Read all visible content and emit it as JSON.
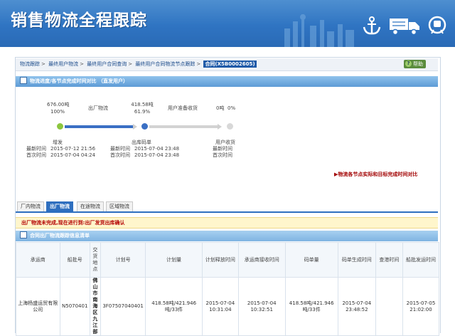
{
  "header": {
    "title": "销售物流全程跟踪"
  },
  "breadcrumb": {
    "items": [
      "物流跟踪",
      "最终用户物流",
      "最终用户合同查询",
      "最终用户合同物流节点跟踪"
    ],
    "current": "合同(X5B0002605)"
  },
  "help_label": "帮助",
  "progress_section": {
    "title": "物流进度/各节点完成时间对比 （直发用户）",
    "stages": [
      {
        "amount": "676.00吨",
        "percent": "100%",
        "status": ""
      },
      {
        "amount": "",
        "percent": "",
        "status": "出厂物流"
      },
      {
        "amount": "418.58吨",
        "percent": "61.9%",
        "status": ""
      },
      {
        "amount": "",
        "percent": "",
        "status": "用户准备收货"
      },
      {
        "amount": "0吨",
        "percent": "0%",
        "status": ""
      }
    ],
    "progress": {
      "segment1": 1.0,
      "segment2": 0.0
    },
    "nodes": [
      {
        "name": "增发",
        "latest_label": "最新时间",
        "latest": "2015-07-12 21:56",
        "first_label": "首次时间",
        "first": "2015-07-04 04:24"
      },
      {
        "name": "出库码单",
        "latest_label": "最新时间",
        "latest": "2015-07-04 23:48",
        "first_label": "首次时间",
        "first": "2015-07-04 23:48"
      },
      {
        "name": "用户收货",
        "latest_label": "最新时间",
        "latest": "",
        "first_label": "首次时间",
        "first": ""
      }
    ],
    "compare_link": "物流各节点实际和目标完成时间对比"
  },
  "tabs": [
    "厂内物流",
    "出厂物流",
    "在途物流",
    "区域物流"
  ],
  "active_tab": 1,
  "warning": "出厂物流未完成,现在进行到:出厂发货出库确认",
  "list_section": {
    "title": "合同出厂物流跟踪信息清单"
  },
  "table": {
    "headers": [
      "承运商",
      "船批号",
      "交货地点",
      "计划号",
      "计划量",
      "计划释放时间",
      "承运商接收时间",
      "码单量",
      "码单生成时间",
      "查港时间",
      "船批发运时间"
    ],
    "rows": [
      [
        "上海杨盛运贸有限公司",
        "N5070401",
        "佛山市南海区九江部",
        "3F07507040401",
        "418.58吨/421.946吨/33件",
        "2015-07-04 10:31:04",
        "2015-07-04 10:32:51",
        "418.58吨/421.946吨/33件",
        "2015-07-04 23:48:52",
        "",
        "2015-07-05 21:02:00"
      ]
    ]
  },
  "colors": {
    "banner": "#2f74c2",
    "accent": "#2f6fbf",
    "warning": "#b30000",
    "node_green": "#8cc63f",
    "node_blue": "#3a6fc4"
  }
}
